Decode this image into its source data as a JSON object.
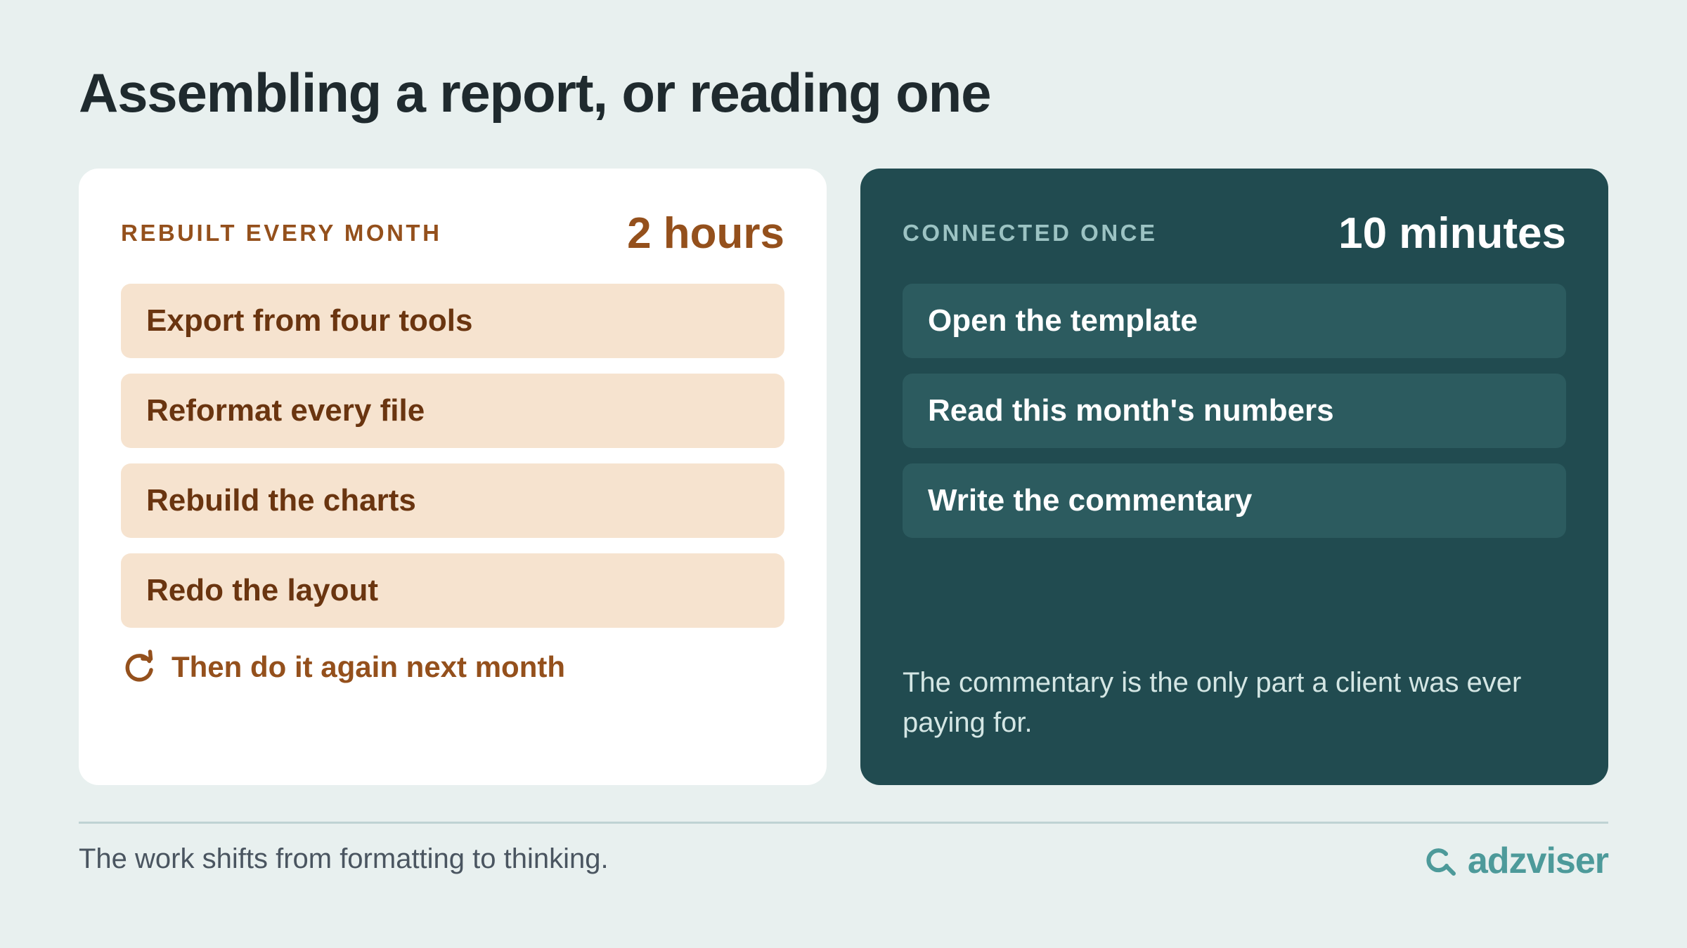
{
  "title": "Assembling a report, or reading one",
  "left_panel": {
    "eyebrow": "REBUILT EVERY MONTH",
    "stat": "2 hours",
    "steps": [
      "Export from four tools",
      "Reformat every file",
      "Rebuild the charts",
      "Redo the layout"
    ],
    "repeat_note": "Then do it again next month",
    "repeat_icon": "refresh-icon"
  },
  "right_panel": {
    "eyebrow": "CONNECTED ONCE",
    "stat": "10 minutes",
    "steps": [
      "Open the template",
      "Read this month's numbers",
      "Write the commentary"
    ],
    "note": "The commentary is the only part a client was ever paying for."
  },
  "footer": {
    "caption": "The work shifts from formatting to thinking.",
    "brand": "adzviser",
    "brand_icon": "magnifier-icon"
  },
  "colors": {
    "background": "#e8f0ef",
    "left_accent": "#94501c",
    "left_step_bg": "#f6e3cf",
    "right_panel_bg": "#214b50",
    "right_step_bg": "#2c5b5f",
    "brand": "#4d9a9a"
  }
}
